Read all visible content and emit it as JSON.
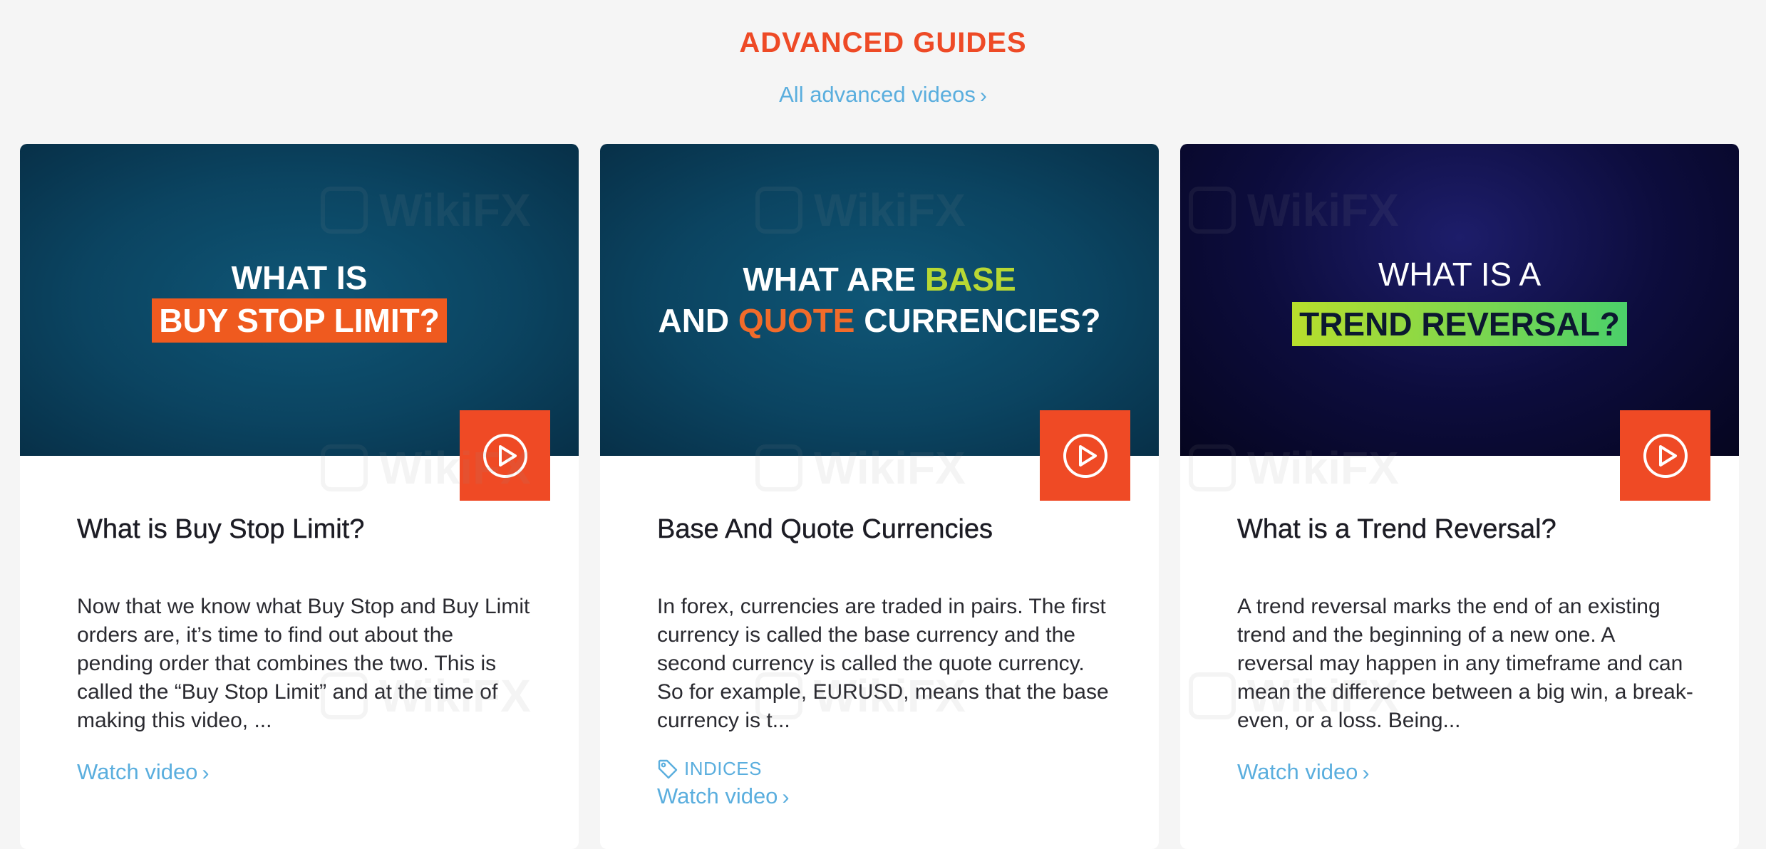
{
  "section": {
    "title": "ADVANCED GUIDES",
    "all_link": "All advanced videos"
  },
  "watermark": "WikiFX",
  "cards": [
    {
      "thumb": {
        "line1": "WHAT IS",
        "box": "BUY STOP LIMIT?"
      },
      "title": "What is Buy Stop Limit?",
      "description": "Now that we know what Buy Stop and Buy Limit orders are, it’s time to find out about the pending order that combines the two. This is called the “Buy Stop Limit” and at the time of making this video, ...",
      "watch": "Watch video"
    },
    {
      "thumb": {
        "l1_a": "WHAT ARE ",
        "l1_b": "BASE",
        "l2_a": "AND ",
        "l2_b": "QUOTE",
        "l2_c": " CURRENCIES?"
      },
      "title": "Base And Quote Currencies",
      "description": "In forex, currencies are traded in pairs. The first currency is called the base currency and the second currency is called the quote currency. So for example, EURUSD, means that the base currency is t...",
      "tag": "INDICES",
      "watch": "Watch video"
    },
    {
      "thumb": {
        "line1": "WHAT IS A",
        "box": "TREND REVERSAL?"
      },
      "title": "What is a Trend Reversal?",
      "description": "A trend reversal marks the end of an existing trend and the beginning of a new one. A reversal may happen in any timeframe and can mean the difference between a big win, a break-even, or a loss. Being...",
      "watch": "Watch video"
    }
  ],
  "colors": {
    "accent": "#ee4a26",
    "link": "#5aaede",
    "background": "#f5f5f5"
  },
  "icons": [
    "play-icon",
    "tag-icon",
    "chevron-right-icon"
  ]
}
